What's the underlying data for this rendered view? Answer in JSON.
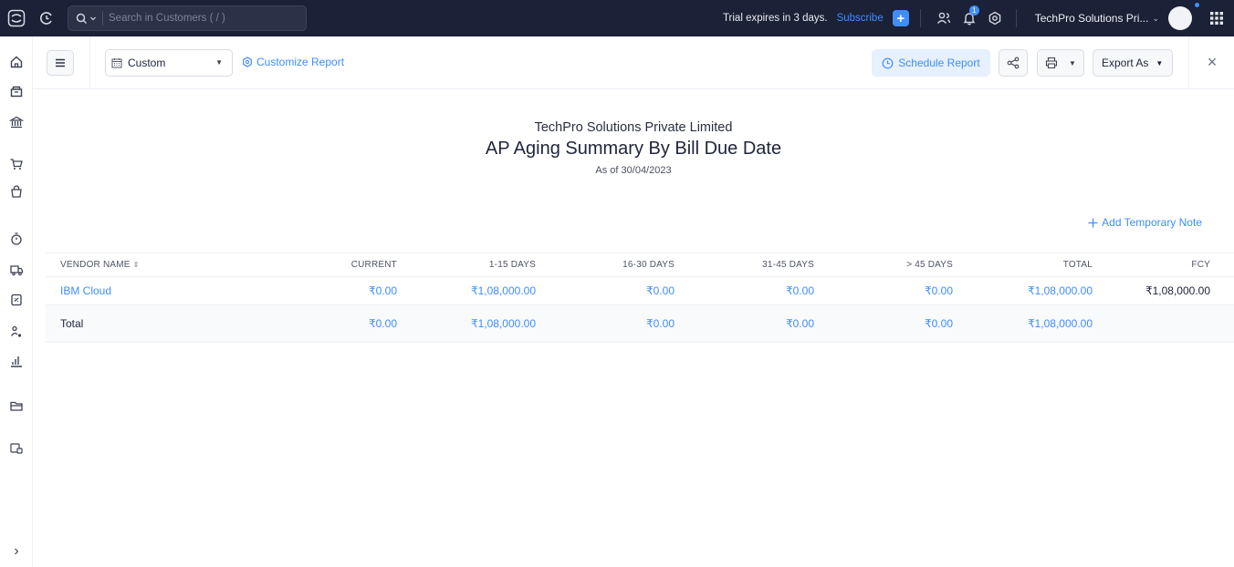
{
  "topbar": {
    "search_placeholder": "Search in Customers ( / )",
    "trial_text": "Trial expires in 3 days.",
    "subscribe_label": "Subscribe",
    "notification_count": "1",
    "org_name": "TechPro Solutions Pri...",
    "icons": {
      "logo": "app-logo-icon",
      "recent": "recent-activity-icon",
      "search": "search-icon",
      "quick_create": "plus-icon",
      "referral": "people-icon",
      "notifications": "bell-icon",
      "settings": "gear-icon",
      "apps": "app-grid-icon"
    }
  },
  "sidebar": {
    "items": [
      "home-icon",
      "items-icon",
      "banking-icon",
      "sales-icon",
      "purchases-icon",
      "time-tracking-icon",
      "eway-bill-icon",
      "accountant-icon",
      "contacts-icon",
      "reports-icon",
      "documents-icon",
      "apps-icon"
    ],
    "expand": "›"
  },
  "toolbar": {
    "date_range": "Custom",
    "customize_label": "Customize Report",
    "schedule_label": "Schedule Report",
    "export_label": "Export As"
  },
  "report": {
    "org_name": "TechPro Solutions Private Limited",
    "title": "AP Aging Summary By Bill Due Date",
    "as_of": "As of 30/04/2023",
    "add_note_label": "Add Temporary Note"
  },
  "table": {
    "columns": [
      "VENDOR NAME",
      "CURRENT",
      "1-15 DAYS",
      "16-30 DAYS",
      "31-45 DAYS",
      "> 45 DAYS",
      "TOTAL",
      "FCY"
    ],
    "rows": [
      [
        "IBM Cloud",
        "₹0.00",
        "₹1,08,000.00",
        "₹0.00",
        "₹0.00",
        "₹0.00",
        "₹1,08,000.00",
        "₹1,08,000.00"
      ]
    ],
    "total_row": [
      "Total",
      "₹0.00",
      "₹1,08,000.00",
      "₹0.00",
      "₹0.00",
      "₹0.00",
      "₹1,08,000.00",
      ""
    ]
  },
  "colors": {
    "topbar_bg": "#1b2136",
    "accent": "#408dfb",
    "schedule_bg": "#e6f0fe"
  }
}
